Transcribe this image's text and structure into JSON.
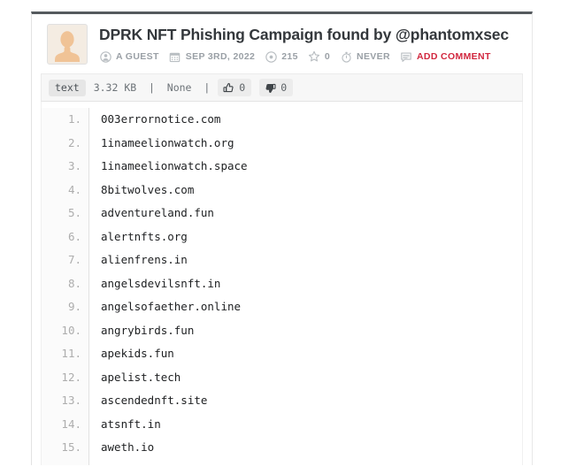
{
  "paste": {
    "title": "DPRK NFT Phishing Campaign found by @phantomxsec",
    "avatar_icon": "default-user-avatar",
    "meta": [
      {
        "icon": "user-icon",
        "label": "A GUEST",
        "link": false
      },
      {
        "icon": "calendar-icon",
        "label": "SEP 3RD, 2022",
        "link": false
      },
      {
        "icon": "eye-icon",
        "label": "215",
        "link": false
      },
      {
        "icon": "star-icon",
        "label": "0",
        "link": false
      },
      {
        "icon": "stopwatch-icon",
        "label": "NEVER",
        "link": false
      },
      {
        "icon": "comment-icon",
        "label": "ADD COMMENT",
        "link": true
      }
    ],
    "toolbar": {
      "syntax_badge": "text",
      "info": "3.32 KB  |  None  |",
      "thumbs_up_icon": "thumbs-up-icon",
      "thumbs_up_count": "0",
      "thumbs_down_icon": "thumbs-down-icon",
      "thumbs_down_count": "0"
    },
    "line_numbers": [
      "1.",
      "2.",
      "3.",
      "4.",
      "5.",
      "6.",
      "7.",
      "8.",
      "9.",
      "10.",
      "11.",
      "12.",
      "13.",
      "14.",
      "15."
    ],
    "lines": [
      "003errornotice.com",
      "1inameelionwatch.org",
      "1inameelionwatch.space",
      "8bitwolves.com",
      "adventureland.fun",
      "alertnfts.org",
      "alienfrens.in",
      "angelsdevilsnft.in",
      "angelsofaether.online",
      "angrybirds.fun",
      "apekids.fun",
      "apelist.tech",
      "ascendednft.site",
      "atsnft.in",
      "aweth.io"
    ]
  },
  "colors": {
    "accent_red": "#d1273e",
    "title_text": "#34383c",
    "meta_text": "#9aa0a6",
    "toolbar_bg": "#f7f7f7",
    "gutter_text": "#adadad",
    "code_text": "#1d1f21",
    "top_rule": "#555a5e"
  }
}
